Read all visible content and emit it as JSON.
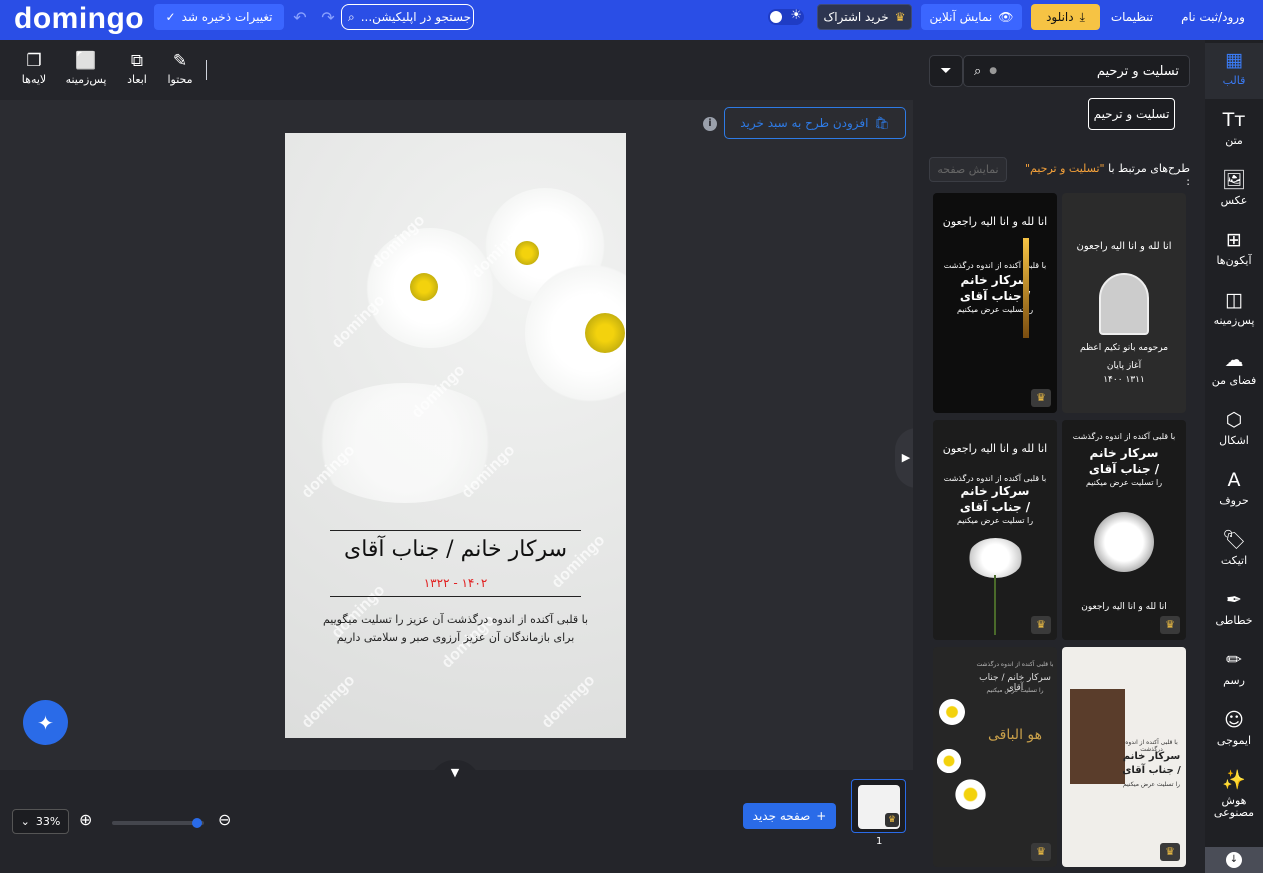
{
  "topbar": {
    "logo": "domingo",
    "save": "تغییرات ذخیره شد",
    "search_placeholder": "جستجو در اپلیکیشن...",
    "subscribe": "خرید اشتراک",
    "preview": "نمایش آنلاین",
    "download": "دانلود",
    "settings": "تنظیمات",
    "login": "ورود/ثبت نام",
    "accent": "#2a4ee6"
  },
  "toolbar": {
    "content": "محتوا",
    "dimensions": "ابعاد",
    "background": "پس‌زمینه",
    "layers": "لایه‌ها"
  },
  "canvas": {
    "add_to_cart": "افزودن طرح به سبد خرید",
    "watermark": "domingo",
    "title": "سرکار خانم / جناب آقای",
    "dates": "۱۴۰۲ - ۱۳۲۲",
    "body_line1": "با قلبی آکنده از اندوه درگذشت آن عزیز را تسلیت میگوییم",
    "body_line2": "برای بازماندگان آن عزیز آرزوی صبر و سلامتی داریم"
  },
  "bottombar": {
    "zoom": "33%",
    "new_page": "صفحه جدید",
    "page_number": "1"
  },
  "panel": {
    "search_value": "تسلیت و ترحیم",
    "chip": "تسلیت و ترحیم",
    "related_prefix": "طرح‌های مرتبط با",
    "related_keyword": "\"تسلیت و ترحیم\"",
    "related_suffix": ":",
    "show_page": "نمایش صفحه",
    "templates": [
      {
        "id": "t1",
        "top_text": "انا لله و انا الیه راجعون",
        "lines": [
          "مرحومه بانو تکیم اعظم",
          "آغاز   پایان",
          "۱۳۱۱   ۱۴۰۰"
        ]
      },
      {
        "id": "t2",
        "top_text": "انا لله و انا الیه راجعون",
        "lines": [
          "با قلبی آکنده از اندوه درگذشت",
          "سرکار خانم",
          "/ جناب آقای",
          "را تسلیت عرض میکنیم"
        ]
      },
      {
        "id": "t3",
        "top_text": "با قلبی آکنده از اندوه درگذشت",
        "lines": [
          "سرکار خانم",
          "/ جناب آقای",
          "را تسلیت عرض میکنیم",
          "انا لله و انا الیه راجعون"
        ]
      },
      {
        "id": "t4",
        "top_text": "انا لله و انا الیه راجعون",
        "lines": [
          "با قلبی آکنده از اندوه درگذشت",
          "سرکار خانم",
          "/ جناب آقای",
          "را تسلیت عرض میکنیم"
        ]
      },
      {
        "id": "t5",
        "top_text": "با قلبی آکنده از اندوه درگذشت",
        "lines": [
          "سرکار خانم",
          "/ جناب آقای",
          "را تسلیت عرض میکنیم"
        ]
      },
      {
        "id": "t6",
        "top_text": "با قلبی آکنده از اندوه درگذشت",
        "lines": [
          "سرکار خانم / جناب آقای",
          "را تسلیت عرض میکنیم",
          "هو الباقی"
        ]
      }
    ]
  },
  "sidebar": {
    "items": [
      {
        "label": "قالب",
        "icon": "template-icon"
      },
      {
        "label": "متن",
        "icon": "text-icon"
      },
      {
        "label": "عکس",
        "icon": "image-icon"
      },
      {
        "label": "آیکون‌ها",
        "icon": "icons-grid-icon"
      },
      {
        "label": "پس‌زمینه",
        "icon": "background-icon"
      },
      {
        "label": "فضای من",
        "icon": "cloud-upload-icon"
      },
      {
        "label": "اشکال",
        "icon": "shapes-icon"
      },
      {
        "label": "حروف",
        "icon": "letters-icon"
      },
      {
        "label": "اتیکت",
        "icon": "sticker-icon"
      },
      {
        "label": "خطاطی",
        "icon": "feather-icon"
      },
      {
        "label": "رسم",
        "icon": "pencil-icon"
      },
      {
        "label": "ایموجی",
        "icon": "emoji-icon"
      },
      {
        "label": "هوش مصنوعی",
        "icon": "magic-wand-icon"
      }
    ]
  }
}
